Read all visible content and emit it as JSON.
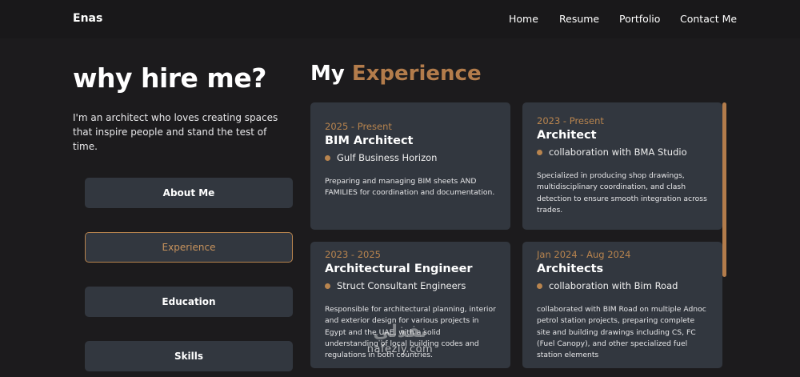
{
  "nav": {
    "brand": "Enas",
    "links": [
      "Home",
      "Resume",
      "Portfolio",
      "Contact Me"
    ]
  },
  "hero": {
    "title": "why hire me?",
    "text": "I'm an architect who loves creating spaces that inspire people and stand the test of time."
  },
  "tabs": [
    {
      "label": "About Me",
      "active": false
    },
    {
      "label": "Experience",
      "active": true
    },
    {
      "label": "Education",
      "active": false
    },
    {
      "label": "Skills",
      "active": false
    }
  ],
  "section": {
    "title_prefix": "My",
    "title_accent": "Experience"
  },
  "experience": [
    {
      "date": "2025 - Present",
      "title": "BIM Architect",
      "company": "Gulf Business Horizon",
      "description": "Preparing and managing BIM sheets AND FAMILIES for coordination and documentation."
    },
    {
      "date": "2023 - Present",
      "title": "Architect",
      "company": "collaboration with BMA Studio",
      "description": "Specialized in producing shop drawings, multidisciplinary coordination, and clash detection to ensure smooth integration across trades."
    },
    {
      "date": "2023 - 2025",
      "title": "Architectural Engineer",
      "company": "Struct Consultant Engineers",
      "description": "Responsible for architectural planning, interior and exterior design for various projects in Egypt and the UAE, with a solid understanding of local building codes and regulations in both countries."
    },
    {
      "date": "Jan 2024 - Aug 2024",
      "title": "Architects",
      "company": "collaboration with Bim Road",
      "description": "collaborated with BIM Road on multiple Adnoc petrol station projects, preparing complete site and building drawings including CS, FC (Fuel Canopy), and other specialized fuel station elements"
    }
  ],
  "watermark": {
    "arabic": "نفذلي",
    "latin": "nafezly.com"
  },
  "colors": {
    "background": "#1c1b1d",
    "card": "#32373f",
    "accent": "#b37c4b"
  }
}
